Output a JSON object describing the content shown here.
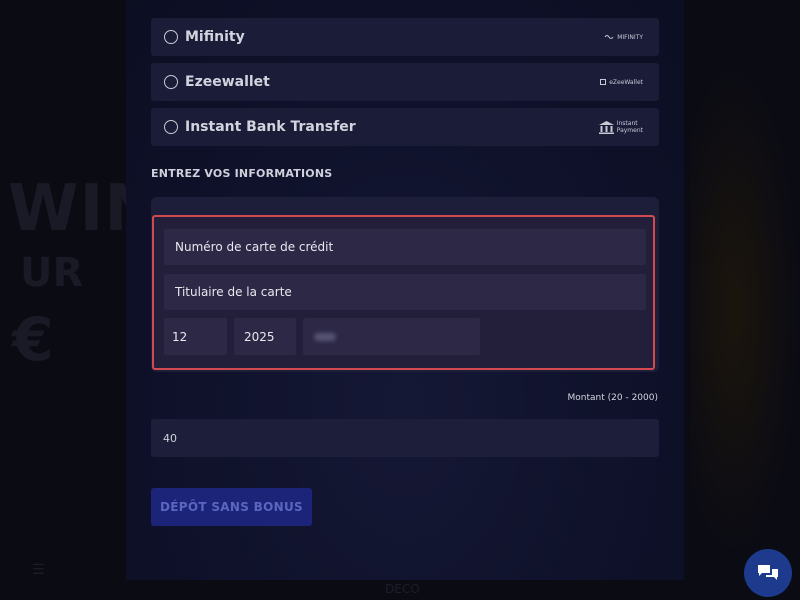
{
  "background": {
    "promo_line1": "WINS",
    "promo_line2": "UR",
    "promo_line3": "€",
    "nav_items": [
      "",
      "DECO",
      ""
    ]
  },
  "payment_methods": [
    {
      "label": "Mifinity",
      "logo_text": "MIFINITY",
      "icon": "mifinity-logo-icon"
    },
    {
      "label": "Ezeewallet",
      "logo_text": "eZeeWallet",
      "icon": "ezeewallet-logo-icon"
    },
    {
      "label": "Instant Bank Transfer",
      "logo_text": "Instant\nPayment",
      "icon": "bank-icon"
    }
  ],
  "section_title": "ENTREZ VOS INFORMATIONS",
  "card_form": {
    "card_number_placeholder": "Numéro de carte de crédit",
    "card_holder_placeholder": "Titulaire de la carte",
    "expiry_month": "12",
    "expiry_year": "2025"
  },
  "amount": {
    "label": "Montant (20 - 2000)",
    "value": "40"
  },
  "deposit_button": "DÉPÔT SANS BONUS",
  "colors": {
    "highlight_border": "#d24a50",
    "button_bg": "#1b2478",
    "chat_bg": "#1e3a8c"
  }
}
